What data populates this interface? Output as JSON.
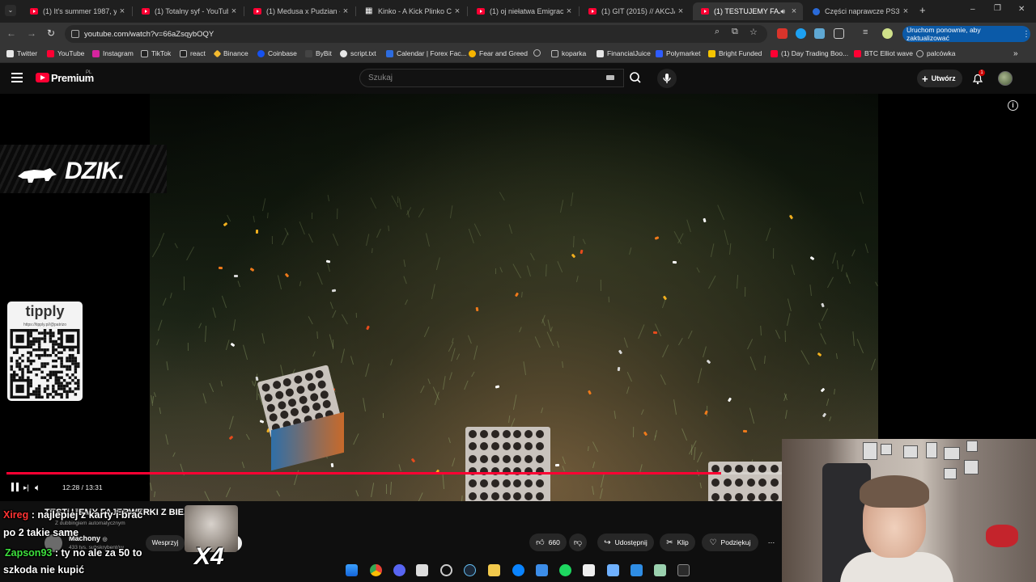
{
  "tabs": [
    {
      "title": "(1) It's summer 1987, you",
      "close": "×"
    },
    {
      "title": "(1) Totalny syf - YouTube",
      "close": "×"
    },
    {
      "title": "(1) Medusa x Pudzian - Ta",
      "close": "×"
    },
    {
      "title": "Kinko - A Kick Plinko Cha",
      "close": "×"
    },
    {
      "title": "(1) oj niełatwa Emigracja",
      "close": "×"
    },
    {
      "title": "(1) GIT (2015) // AKCJA / L",
      "close": "×"
    },
    {
      "title": "(1) TESTUJEMY FAJER",
      "close": "×"
    },
    {
      "title": "Części naprawcze PS3",
      "close": "×"
    }
  ],
  "new_tab": "+",
  "window_controls": {
    "minimize": "–",
    "restore": "❐",
    "close": "✕"
  },
  "address": {
    "url": "youtube.com/watch?v=66aZsqybOQY",
    "update_button": "Uruchom ponownie, aby zaktualizować"
  },
  "bookmarks": [
    {
      "label": "Twitter",
      "color": "#e6e6e6"
    },
    {
      "label": "YouTube",
      "color": "#ff0033"
    },
    {
      "label": "Instagram",
      "color": "#d6249f"
    },
    {
      "label": "TikTok",
      "color": "#e6e6e6"
    },
    {
      "label": "react",
      "color": "#e6e6e6"
    },
    {
      "label": "Binance",
      "color": "#f3ba2f"
    },
    {
      "label": "Coinbase",
      "color": "#1652f0"
    },
    {
      "label": "ByBit",
      "color": "#e6e6e6"
    },
    {
      "label": "script.txt",
      "color": "#e6e6e6"
    },
    {
      "label": "Calendar | Forex Fac...",
      "color": "#2d6cdf"
    },
    {
      "label": "Fear and Greed",
      "color": "#f6b400"
    },
    {
      "label": "",
      "color": "#bbbbbb"
    },
    {
      "label": "koparka",
      "color": "#bbbbbb"
    },
    {
      "label": "FinancialJuice",
      "color": "#e6e6e6"
    },
    {
      "label": "Polymarket",
      "color": "#2e5cff"
    },
    {
      "label": "Bright Funded",
      "color": "#f5c400"
    },
    {
      "label": "(1) Day Trading Boo...",
      "color": "#ff0033"
    },
    {
      "label": "BTC Elliot wave",
      "color": "#ff0033"
    },
    {
      "label": "palcówka",
      "color": "#bbbbbb"
    }
  ],
  "youtube": {
    "logo_text": "Premium",
    "region": "PL",
    "search_placeholder": "Szukaj",
    "create_label": "Utwórz",
    "notification_count": "1"
  },
  "video": {
    "overlay_brand": "DZIK.",
    "tipply_title": "tipply",
    "tipply_url": "https://tipply.pl/@patrizo",
    "time": "12:28 / 13:31",
    "progress": 0.922,
    "info_icon": "i"
  },
  "details": {
    "title": "TESTUJEMY FAJERWERKI Z BIE... 50ZŁ",
    "dub_note": "Z dubbingiem automatycznym",
    "channel": "Machony",
    "channel_verified": "◎",
    "subs": "433 tys. subskrybentów",
    "support": "Wesprzyj",
    "likes": "660",
    "share": "Udostępnij",
    "clip": "Klip",
    "thanks": "Podziękuj",
    "more": "⋯",
    "overlay_multiplier": "X4"
  },
  "chat": [
    {
      "user": "Xireg",
      "text": " : najlepiej z karty i brać",
      "user_color": "#ff3333"
    },
    {
      "user": "",
      "text": "po 2 takie same",
      "user_color": "#ffffff"
    },
    {
      "user": "Zapson93",
      "text": " : ty no ale za 50 to",
      "user_color": "#3de03d"
    },
    {
      "user": "",
      "text": "szkoda nie kupić",
      "user_color": "#ffffff"
    }
  ]
}
